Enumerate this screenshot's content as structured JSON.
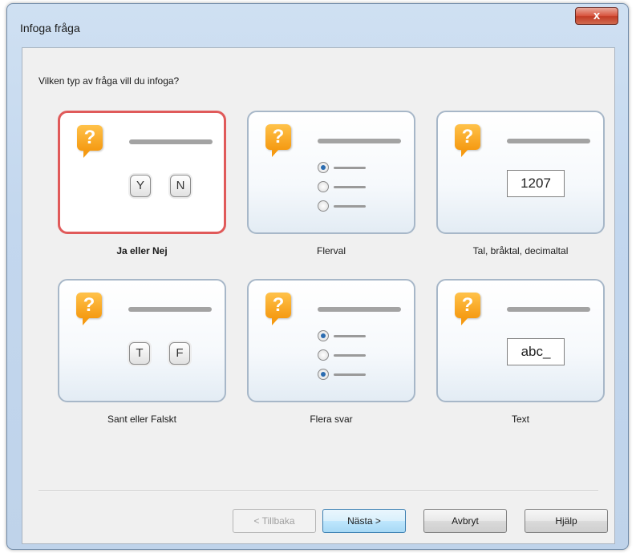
{
  "window": {
    "title": "Infoga fråga",
    "close_label": "x"
  },
  "prompt": "Vilken typ av fråga vill du infoga?",
  "question_icon_glyph": "?",
  "options": [
    {
      "label": "Ja eller Nej",
      "selected": true,
      "keys": [
        "Y",
        "N"
      ]
    },
    {
      "label": "Flerval",
      "selected": false
    },
    {
      "label": "Tal, bråktal, decimaltal",
      "selected": false,
      "value": "1207"
    },
    {
      "label": "Sant eller Falskt",
      "selected": false,
      "keys": [
        "T",
        "F"
      ]
    },
    {
      "label": "Flera svar",
      "selected": false
    },
    {
      "label": "Text",
      "selected": false,
      "value": "abc_"
    }
  ],
  "buttons": {
    "back": "< Tillbaka",
    "next": "Nästa >",
    "cancel": "Avbryt",
    "help": "Hjälp"
  },
  "colors": {
    "selected_border": "#e05a5a",
    "question_icon": "#f59a12",
    "radio_fill": "#2b6cb0"
  }
}
